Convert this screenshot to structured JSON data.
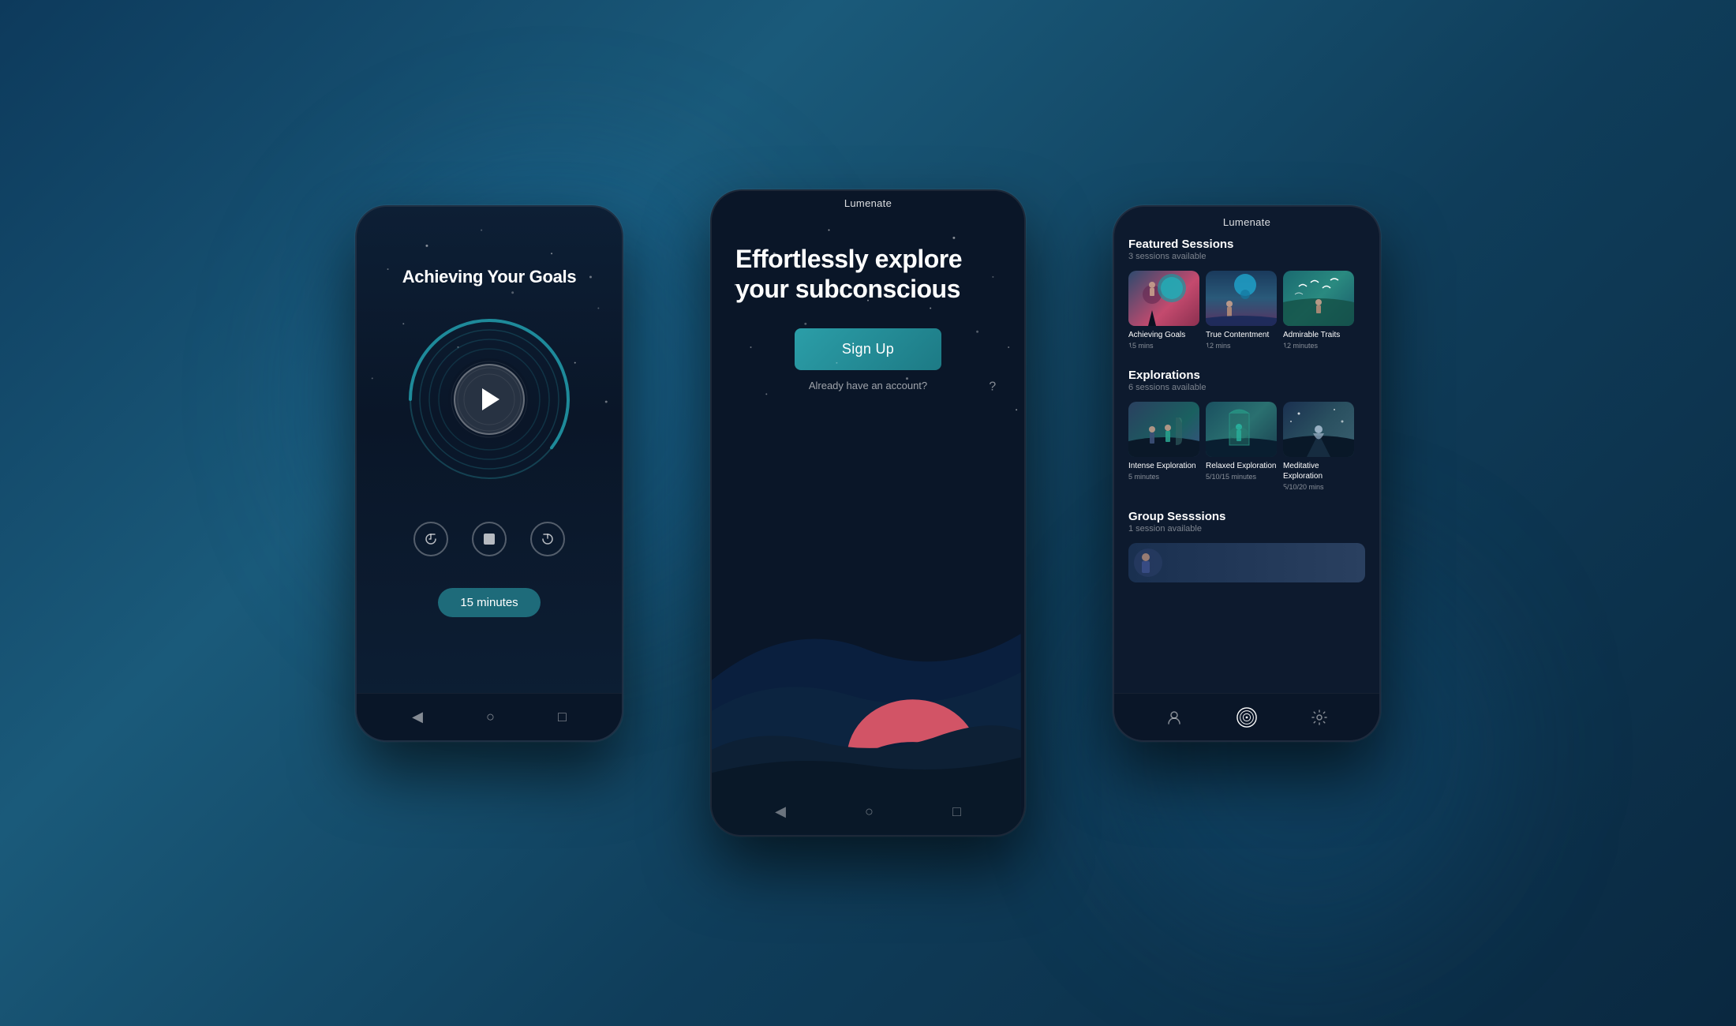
{
  "app": {
    "name": "Lumenate"
  },
  "background": {
    "colors": [
      "#0d3a5c",
      "#1a5a7a",
      "#0a2840"
    ]
  },
  "leftPhone": {
    "sessionTitle": "Achieving Your Goals",
    "duration": "15 minutes",
    "controls": {
      "rewind": "⟲",
      "stop": "■",
      "forward": "⟳"
    }
  },
  "centerPhone": {
    "appTitle": "Lumenate",
    "tagline": "Effortlessly explore your subconscious",
    "signupButton": "Sign Up",
    "signinText": "Already have an account?"
  },
  "rightPhone": {
    "appTitle": "Lumenate",
    "sections": [
      {
        "title": "Featured Sessions",
        "subtitle": "3 sessions available",
        "cards": [
          {
            "label": "Achieving Goals",
            "duration": "15 mins",
            "thumbClass": "thumb-goals"
          },
          {
            "label": "True Contentment",
            "duration": "12 mins",
            "thumbClass": "thumb-contentment"
          },
          {
            "label": "Admirable Traits",
            "duration": "12 minutes",
            "thumbClass": "thumb-admirable"
          }
        ]
      },
      {
        "title": "Explorations",
        "subtitle": "6 sessions available",
        "cards": [
          {
            "label": "Intense Exploration",
            "duration": "5 minutes",
            "thumbClass": "thumb-intense"
          },
          {
            "label": "Relaxed Exploration",
            "duration": "5/10/15 minutes",
            "thumbClass": "thumb-relaxed"
          },
          {
            "label": "Meditative Exploration",
            "duration": "5/10/20 mins",
            "thumbClass": "thumb-meditative"
          }
        ]
      },
      {
        "title": "Group Sesssions",
        "subtitle": "1 session available"
      }
    ],
    "nav": {
      "icons": [
        "user",
        "home",
        "gear"
      ]
    }
  }
}
